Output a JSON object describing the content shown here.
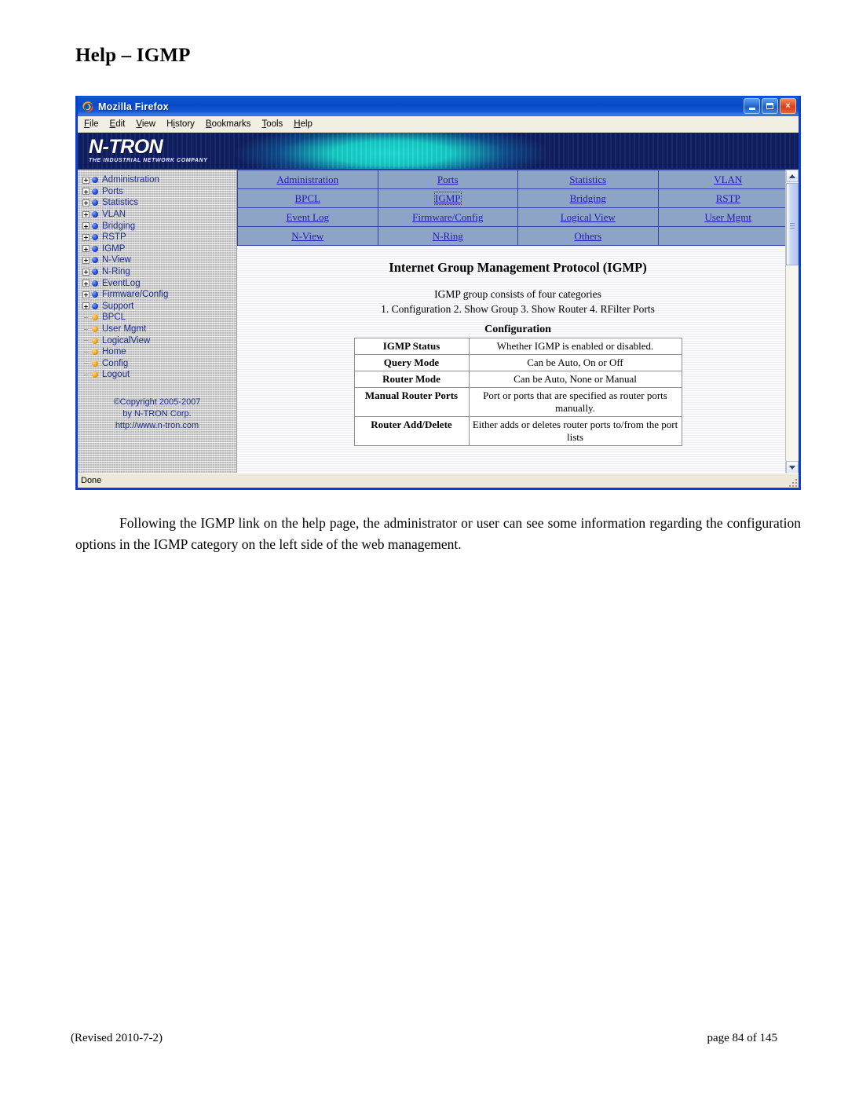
{
  "document": {
    "title": "Help – IGMP",
    "paragraph": "Following the IGMP link on the help page, the administrator or user can see some information regarding the configuration options in the IGMP category on the left side of the web management.",
    "footer_left": "(Revised 2010-7-2)",
    "footer_right": "page 84 of 145"
  },
  "browser": {
    "window_title": "Mozilla Firefox",
    "menu": [
      "File",
      "Edit",
      "View",
      "History",
      "Bookmarks",
      "Tools",
      "Help"
    ],
    "menu_accel": [
      "F",
      "E",
      "V",
      "i",
      "B",
      "T",
      "H"
    ],
    "status": "Done",
    "window_buttons": {
      "minimize": "minimize-button",
      "maximize": "maximize-button",
      "close": "×"
    }
  },
  "banner": {
    "logo": "N-TRON",
    "tagline": "THE INDUSTRIAL NETWORK COMPANY"
  },
  "sidebar": {
    "tree": [
      {
        "label": "Administration",
        "expandable": true,
        "bullet": "blue"
      },
      {
        "label": "Ports",
        "expandable": true,
        "bullet": "blue"
      },
      {
        "label": "Statistics",
        "expandable": true,
        "bullet": "blue"
      },
      {
        "label": "VLAN",
        "expandable": true,
        "bullet": "blue"
      },
      {
        "label": "Bridging",
        "expandable": true,
        "bullet": "blue"
      },
      {
        "label": "RSTP",
        "expandable": true,
        "bullet": "blue"
      },
      {
        "label": "IGMP",
        "expandable": true,
        "bullet": "blue"
      },
      {
        "label": "N-View",
        "expandable": true,
        "bullet": "blue"
      },
      {
        "label": "N-Ring",
        "expandable": true,
        "bullet": "blue"
      },
      {
        "label": "EventLog",
        "expandable": true,
        "bullet": "blue"
      },
      {
        "label": "Firmware/Config",
        "expandable": true,
        "bullet": "blue"
      },
      {
        "label": "Support",
        "expandable": true,
        "bullet": "blue"
      },
      {
        "label": "BPCL",
        "expandable": false,
        "bullet": "orange"
      },
      {
        "label": "User Mgmt",
        "expandable": false,
        "bullet": "orange"
      },
      {
        "label": "LogicalView",
        "expandable": false,
        "bullet": "orange"
      },
      {
        "label": "Home",
        "expandable": false,
        "bullet": "orange"
      },
      {
        "label": "Config",
        "expandable": false,
        "bullet": "orange"
      },
      {
        "label": "Logout",
        "expandable": false,
        "bullet": "orange"
      }
    ],
    "copyright_line1": "©Copyright 2005-2007",
    "copyright_line2": "by N-TRON Corp.",
    "copyright_line3": "http://www.n-tron.com"
  },
  "navgrid": {
    "rows": [
      [
        {
          "label": "Administration",
          "active": false
        },
        {
          "label": "Ports",
          "active": false
        },
        {
          "label": "Statistics",
          "active": false
        },
        {
          "label": "VLAN",
          "active": false
        }
      ],
      [
        {
          "label": "BPCL",
          "active": false
        },
        {
          "label": "IGMP",
          "active": true
        },
        {
          "label": "Bridging",
          "active": false
        },
        {
          "label": "RSTP",
          "active": false
        }
      ],
      [
        {
          "label": "Event Log",
          "active": false
        },
        {
          "label": "Firmware/Config",
          "active": false
        },
        {
          "label": "Logical View",
          "active": false
        },
        {
          "label": "User Mgmt",
          "active": false
        }
      ],
      [
        {
          "label": "N-View",
          "active": false
        },
        {
          "label": "N-Ring",
          "active": false
        },
        {
          "label": "Others",
          "active": false
        },
        {
          "label": "",
          "active": false
        }
      ]
    ]
  },
  "page": {
    "heading": "Internet Group Management Protocol (IGMP)",
    "subtitle": "IGMP group consists of four categories",
    "categories_line": "1. Configuration   2. Show Group   3. Show Router   4. RFilter Ports",
    "table": {
      "caption": "Configuration",
      "rows": [
        {
          "key": "IGMP Status",
          "value": "Whether IGMP is enabled or disabled."
        },
        {
          "key": "Query Mode",
          "value": "Can be Auto, On or Off"
        },
        {
          "key": "Router Mode",
          "value": "Can be Auto, None or Manual"
        },
        {
          "key": "Manual Router Ports",
          "value": "Port or ports that are specified as router ports manually."
        },
        {
          "key": "Router Add/Delete",
          "value": "Either adds or deletes router ports to/from the port lists"
        }
      ]
    }
  },
  "colors": {
    "titlebar_blue": "#0d53cf",
    "nav_cell": "#8ea4c6",
    "link_blue": "#2219b4",
    "tree_text": "#1b2d8f",
    "banner_navy": "#0f2f7a",
    "banner_cyan": "#17cfc9"
  }
}
